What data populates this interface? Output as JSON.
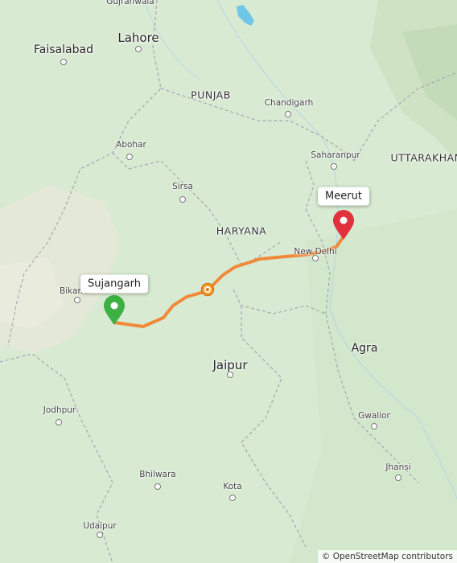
{
  "map": {
    "cities_large": [
      "Lahore",
      "Faisalabad",
      "Jaipur",
      "Agra"
    ],
    "cities_small": [
      "Chandigarh",
      "Abohar",
      "Saharanpur",
      "Sirsa",
      "New Delhi",
      "Bikaner",
      "Jodhpur",
      "Gwalior",
      "Bhilwara",
      "Jhansi",
      "Kota",
      "Udaipur",
      "Gujranwala"
    ],
    "regions": [
      "PUNJAB",
      "HARYANA",
      "UTTARAKHAN"
    ],
    "route": {
      "origin": "Sujangarh",
      "destination": "Meerut",
      "color": "#f08a3a",
      "origin_marker_color": "#3cb043",
      "destination_marker_color": "#e0313c",
      "shield_color": "#f08a1c"
    },
    "attribution": "© OpenStreetMap contributors"
  }
}
